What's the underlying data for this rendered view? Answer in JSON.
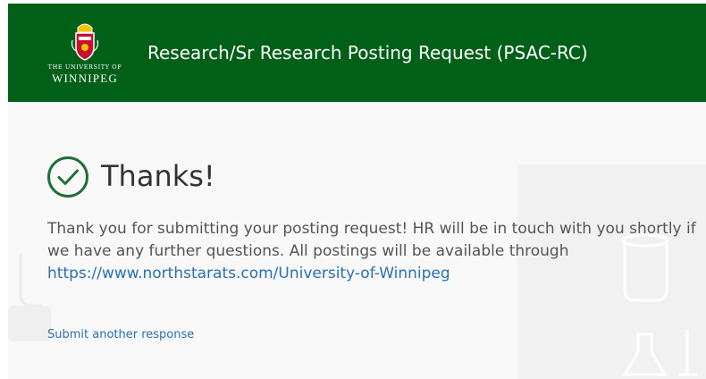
{
  "colors": {
    "header_bg": "#006018",
    "accent_green": "#1f6f3b",
    "link_blue": "#2a6fb5",
    "body_text": "#555555",
    "page_bg": "#f7f8f7"
  },
  "header": {
    "logo": {
      "line1": "THE UNIVERSITY OF",
      "line2": "WINNIPEG",
      "crest_icon": "university-crest-icon"
    },
    "title": "Research/Sr Research Posting Request (PSAC-RC)"
  },
  "confirmation": {
    "icon": "checkmark-circle-icon",
    "heading": "Thanks!",
    "message_line1": "Thank you for submitting your posting request! HR will be in touch with you shortly if",
    "message_line2": "we have any further questions. All postings will be available through",
    "link_text": "https://www.northstarats.com/University-of-Winnipeg",
    "submit_another_label": "Submit another response"
  }
}
